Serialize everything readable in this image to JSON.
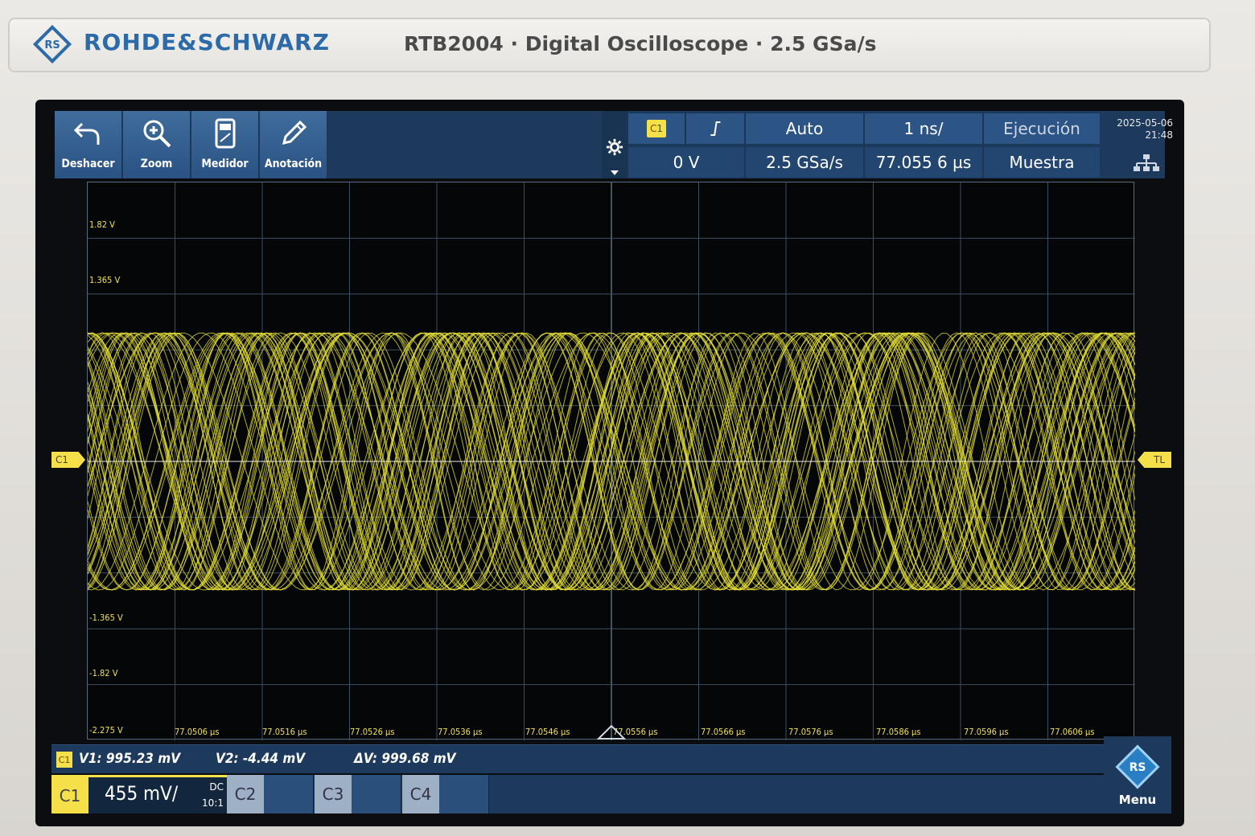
{
  "bezel": {
    "brand": "ROHDE&SCHWARZ",
    "model": "RTB2004 · Digital Oscilloscope · 2.5 GSa/s",
    "logo_text": "R&S"
  },
  "toolbar": {
    "buttons": [
      {
        "label": "Deshacer",
        "icon": "undo-icon"
      },
      {
        "label": "Zoom",
        "icon": "zoom-icon"
      },
      {
        "label": "Medidor",
        "icon": "meter-icon"
      },
      {
        "label": "Anotación",
        "icon": "pencil-icon"
      }
    ]
  },
  "status": {
    "channel": "C1",
    "trigger_slope": "⌠",
    "trigger_mode": "Auto",
    "timebase": "1 ns/",
    "run_state": "Ejecución",
    "trigger_level": "0 V",
    "sample_rate": "2.5 GSa/s",
    "trigger_time": "77.055 6 µs",
    "acquisition": "Muestra",
    "date": "2025-05-06",
    "time": "21:48"
  },
  "grid": {
    "y_labels": [
      "1.82 V",
      "1.365 V",
      "-1.365 V",
      "-1.82 V",
      "-2.275 V"
    ],
    "x_labels": [
      "77.0506 µs",
      "77.0516 µs",
      "77.0526 µs",
      "77.0536 µs",
      "77.0546 µs",
      "77.0556 µs",
      "77.0566 µs",
      "77.0576 µs",
      "77.0586 µs",
      "77.0596 µs",
      "77.0606 µs"
    ],
    "left_marker": "C1",
    "right_marker": "TL",
    "trace_color": "#e6e03a",
    "amplitude_volts": 0.99
  },
  "readout": {
    "channel": "C1",
    "v1": "V1: 995.23 mV",
    "v2": "V2: -4.44 mV",
    "dv": "ΔV: 999.68 mV"
  },
  "channels": {
    "c1_label": "C1",
    "c1_scale": "455 mV/",
    "c1_coupling": "DC",
    "c1_probe": "10:1",
    "c2_label": "C2",
    "c3_label": "C3",
    "c4_label": "C4",
    "menu_label": "Menu"
  }
}
